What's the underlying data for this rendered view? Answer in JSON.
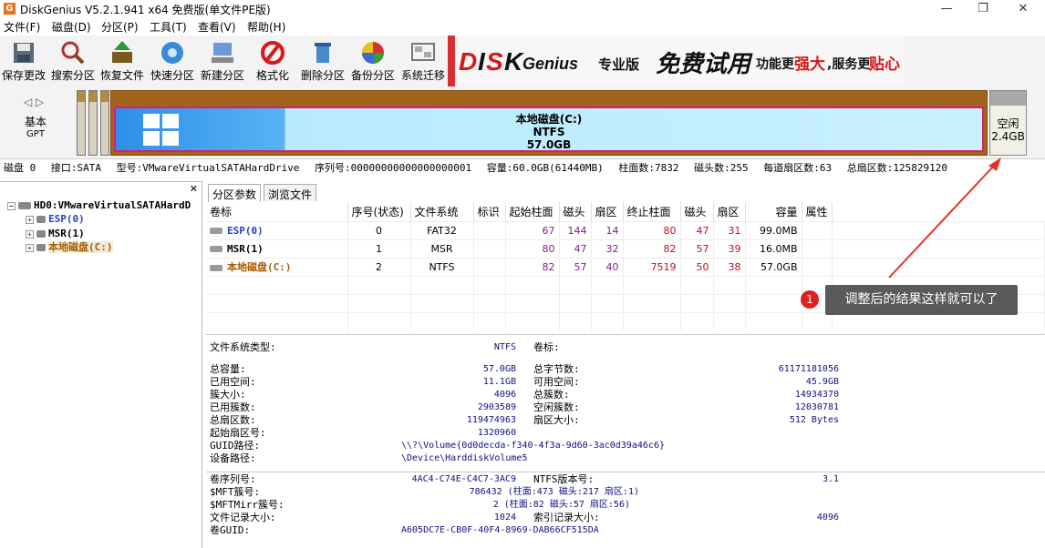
{
  "window": {
    "title": "DiskGenius V5.2.1.941 x64 免费版(单文件PE版)",
    "icon_letter": "G",
    "minimize": "—",
    "maximize": "❐",
    "close": "✕"
  },
  "menu": [
    "文件(F)",
    "磁盘(D)",
    "分区(P)",
    "工具(T)",
    "查看(V)",
    "帮助(H)"
  ],
  "toolbar": [
    {
      "label": "保存更改",
      "icon": "save-icon"
    },
    {
      "label": "搜索分区",
      "icon": "search-icon"
    },
    {
      "label": "恢复文件",
      "icon": "recover-icon"
    },
    {
      "label": "快速分区",
      "icon": "quick-partition-icon"
    },
    {
      "label": "新建分区",
      "icon": "new-partition-icon"
    },
    {
      "label": "格式化",
      "icon": "format-icon"
    },
    {
      "label": "删除分区",
      "icon": "delete-icon"
    },
    {
      "label": "备份分区",
      "icon": "backup-icon"
    },
    {
      "label": "系统迁移",
      "icon": "migrate-icon"
    }
  ],
  "banner": {
    "brand_d": "D",
    "brand_i": "I",
    "brand_s": "S",
    "brand_k": "K",
    "brand_genius": "Genius",
    "edition": "专业版",
    "free_trial": "免费试用",
    "slogan_1": "功能更",
    "slogan_2": "强大",
    "slogan_3": ",服务更",
    "slogan_4": "贴心"
  },
  "diskmap": {
    "nav": "◁ ▷",
    "type": "基本",
    "style": "GPT",
    "partition": {
      "name": "本地磁盘(C:)",
      "fs": "NTFS",
      "size": "57.0GB"
    },
    "free": {
      "label": "空闲",
      "size": "2.4GB"
    }
  },
  "diskinfo": {
    "disk": "磁盘 0",
    "interface": "接口:SATA",
    "model": "型号:VMwareVirtualSATAHardDrive",
    "serial": "序列号:00000000000000000001",
    "capacity": "容量:60.0GB(61440MB)",
    "cylinders": "柱面数:7832",
    "heads": "磁头数:255",
    "sectors_per_track": "每道扇区数:63",
    "total_sectors": "总扇区数:125829120"
  },
  "tree": {
    "close": "✕",
    "disk": "HD0:VMwareVirtualSATAHardD",
    "partitions": [
      "ESP(0)",
      "MSR(1)",
      "本地磁盘(C:)"
    ]
  },
  "tabs": [
    "分区参数",
    "浏览文件"
  ],
  "table": {
    "headers": [
      "卷标",
      "序号(状态)",
      "文件系统",
      "标识",
      "起始柱面",
      "磁头",
      "扇区",
      "终止柱面",
      "磁头",
      "扇区",
      "容量",
      "属性"
    ],
    "rows": [
      {
        "label": "ESP(0)",
        "index": "0",
        "fs": "FAT32",
        "flag": "",
        "start_cyl": "67",
        "start_head": "144",
        "start_sec": "14",
        "end_cyl": "80",
        "end_head": "47",
        "end_sec": "31",
        "size": "99.0MB",
        "attr": ""
      },
      {
        "label": "MSR(1)",
        "index": "1",
        "fs": "MSR",
        "flag": "",
        "start_cyl": "80",
        "start_head": "47",
        "start_sec": "32",
        "end_cyl": "82",
        "end_head": "57",
        "end_sec": "39",
        "size": "16.0MB",
        "attr": ""
      },
      {
        "label": "本地磁盘(C:)",
        "index": "2",
        "fs": "NTFS",
        "flag": "",
        "start_cyl": "82",
        "start_head": "57",
        "start_sec": "40",
        "end_cyl": "7519",
        "end_head": "50",
        "end_sec": "38",
        "size": "57.0GB",
        "attr": ""
      }
    ]
  },
  "details": {
    "fs_type_label": "文件系统类型:",
    "fs_type": "NTFS",
    "vol_label_label": "卷标:",
    "total_label": "总容量:",
    "total": "57.0GB",
    "total_bytes_label": "总字节数:",
    "total_bytes": "61171181056",
    "used_label": "已用空间:",
    "used": "11.1GB",
    "free_label": "可用空间:",
    "free": "45.9GB",
    "cluster_label": "簇大小:",
    "cluster": "4096",
    "clusters_label": "总簇数:",
    "clusters": "14934370",
    "used_clusters_label": "已用簇数:",
    "used_clusters": "2903589",
    "free_clusters_label": "空闲簇数:",
    "free_clusters": "12030781",
    "sectors_label": "总扇区数:",
    "sectors": "119474963",
    "sector_size_label": "扇区大小:",
    "sector_size": "512 Bytes",
    "start_sector_label": "起始扇区号:",
    "start_sector": "1320960",
    "guid_path_label": "GUID路径:",
    "guid_path": "\\\\?\\Volume{0d0decda-f340-4f3a-9d60-3ac0d39a46c6}",
    "device_path_label": "设备路径:",
    "device_path": "\\Device\\HarddiskVolume5",
    "serial_label": "卷序列号:",
    "serial": "4AC4-C74E-C4C7-3AC9",
    "ntfs_ver_label": "NTFS版本号:",
    "ntfs_ver": "3.1",
    "mft_label": "$MFT簇号:",
    "mft": "786432 (柱面:473 磁头:217 扇区:1)",
    "mftmirr_label": "$MFTMirr簇号:",
    "mftmirr": "2 (柱面:82 磁头:57 扇区:56)",
    "record_size_label": "文件记录大小:",
    "record_size": "1024",
    "index_size_label": "索引记录大小:",
    "index_size": "4096",
    "vol_guid_label": "卷GUID:",
    "vol_guid": "A605DC7E-CB0F-40F4-8969-DAB66CF515DA"
  },
  "annotation": {
    "badge": "1",
    "text": "调整后的结果这样就可以了"
  },
  "colors": {
    "accent_pink": "#e0187d",
    "partition_brown": "#a0641c",
    "value_purple": "#8a1a8a",
    "value_red": "#c0101a",
    "callout": "#5a5a5a",
    "arrow": "#e8302a"
  }
}
